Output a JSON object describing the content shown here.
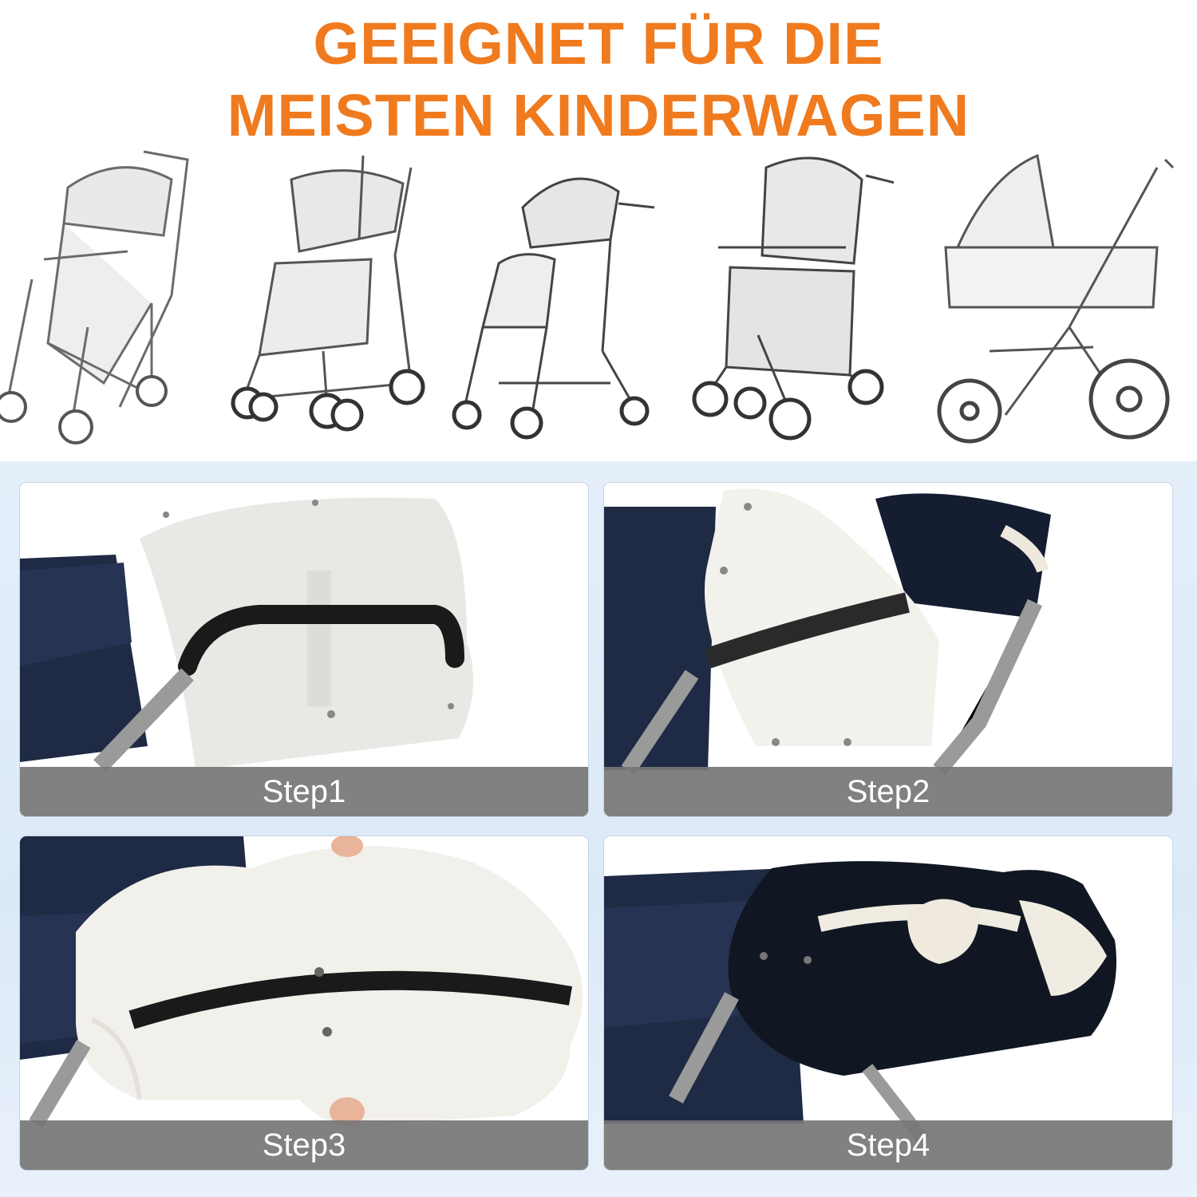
{
  "headline": {
    "line1": "GEEIGNET FÜR DIE",
    "line2": "MEISTEN KINDERWAGEN",
    "color": "#f07a1e"
  },
  "strollers": [
    {
      "icon": "stroller-sketch-icon"
    },
    {
      "icon": "umbrella-stroller-sketch-icon"
    },
    {
      "icon": "compact-stroller-sketch-icon"
    },
    {
      "icon": "travel-system-sketch-icon"
    },
    {
      "icon": "pram-sketch-icon"
    }
  ],
  "steps": [
    {
      "label": "Step1"
    },
    {
      "label": "Step2"
    },
    {
      "label": "Step3"
    },
    {
      "label": "Step4"
    }
  ],
  "colors": {
    "accent": "#f07a1e",
    "navy": "#1f2a44",
    "fleece": "#f1efea",
    "step_bar": "#767676"
  }
}
